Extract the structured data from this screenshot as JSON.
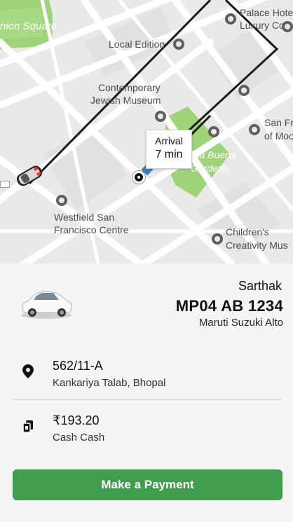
{
  "map": {
    "labels": {
      "union_square": "nion Square",
      "palace_hotel": "Palace Hote",
      "luxury_coll": "Luxury Coll",
      "local_edition": "Local Edition",
      "contemporary": "Contemporary",
      "jewish_museum": "Jewish Museum",
      "san_fr": "San Fr",
      "of_mo": "of Moc",
      "yerba_buena": "rba Buena",
      "gardens": "Gardens",
      "westfield": "Westfield San",
      "francisco_centre": "Francisco Centre",
      "childrens": "Children's",
      "creativity": "Creativity Mus"
    },
    "arrival": {
      "label": "Arrival",
      "time": "7 min"
    }
  },
  "ride": {
    "driver_name": "Sarthak",
    "plate": "MP04 AB 1234",
    "model": "Maruti Suzuki Alto",
    "destination_title": "562/11-A",
    "destination_subtitle": "Kankariya Talab, Bhopal",
    "fare": "₹193.20",
    "payment_method": "Cash Cash"
  },
  "actions": {
    "pay_label": "Make a Payment"
  },
  "colors": {
    "accent": "#3f9d4e",
    "park": "#9ed37a",
    "route": "#1a1a1a"
  },
  "icons": {
    "location": "location-pin-icon",
    "fare": "cash-icon",
    "car": "car-icon"
  }
}
